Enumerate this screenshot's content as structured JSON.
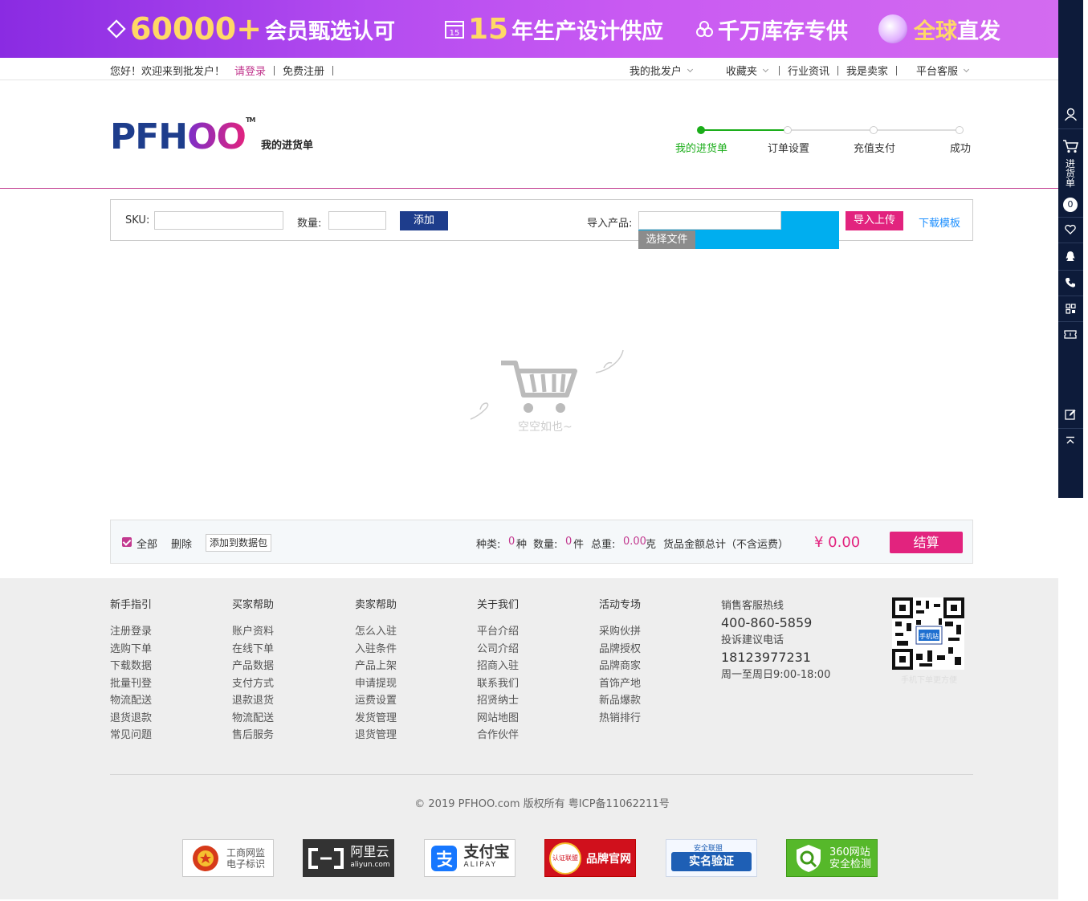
{
  "banner": {
    "seg1_num": "60000+",
    "seg1_txt": "会员甄选认可",
    "seg2_icon": "15",
    "seg2_num": "15",
    "seg2_txt": "年生产设计供应",
    "seg3_txt": "千万库存专供",
    "seg4_txt_a": "全球",
    "seg4_txt_b": "直发"
  },
  "topbar": {
    "greeting": "您好！欢迎来到批发户！",
    "login": "请登录",
    "register": "免费注册",
    "my_account": "我的批发户",
    "favorites": "收藏夹",
    "industry_news": "行业资讯",
    "i_am_seller": "我是卖家",
    "customer_service": "平台客服"
  },
  "header": {
    "logo_a": "PFH",
    "logo_b": "OO",
    "logo_tm": "TM",
    "page_name": "我的进货单",
    "steps": [
      "我的进货单",
      "订单设置",
      "充值支付",
      "成功"
    ]
  },
  "toolbox": {
    "sku_label": "SKU:",
    "qty_label": "数量:",
    "add_btn": "添加",
    "import_label": "导入产品:",
    "choose_file": "选择文件",
    "import_upload": "导入上传",
    "download_template": "下载模板"
  },
  "empty": {
    "text": "空空如也~"
  },
  "cartbar": {
    "all": "全部",
    "delete": "删除",
    "add_to_pkg": "添加到数据包",
    "kinds_label": "种类:",
    "kinds_value": "0",
    "kinds_unit": "种",
    "qty_label": "数量:",
    "qty_value": "0",
    "qty_unit": "件",
    "weight_label": "总重:",
    "weight_value": "0.00",
    "weight_unit": "克",
    "amount_label": "货品金额总计（不含运费）",
    "total": "¥ 0.00",
    "settle": "结算"
  },
  "footer": {
    "columns": [
      {
        "title": "新手指引",
        "items": [
          "注册登录",
          "选购下单",
          "下载数据",
          "批量刊登",
          "物流配送",
          "退货退款",
          "常见问题"
        ]
      },
      {
        "title": "买家帮助",
        "items": [
          "账户资料",
          "在线下单",
          "产品数据",
          "支付方式",
          "退款退货",
          "物流配送",
          "售后服务"
        ]
      },
      {
        "title": "卖家帮助",
        "items": [
          "怎么入驻",
          "入驻条件",
          "产品上架",
          "申请提现",
          "运费设置",
          "发货管理",
          "退货管理"
        ]
      },
      {
        "title": "关于我们",
        "items": [
          "平台介绍",
          "公司介绍",
          "招商入驻",
          "联系我们",
          "招贤纳士",
          "网站地图",
          "合作伙伴"
        ]
      },
      {
        "title": "活动专场",
        "items": [
          "采购伙拼",
          "品牌授权",
          "品牌商家",
          "首饰产地",
          "新品爆款",
          "热销排行"
        ]
      }
    ],
    "contact": {
      "sales_label": "销售客服热线",
      "sales_phone": "400-860-5859",
      "complaint_label": "投诉建议电话",
      "complaint_phone": "18123977231",
      "hours": "周一至周日9:00-18:00"
    },
    "qr_caption": "手机下单更方便",
    "qr_badge": "手机站",
    "copyright": "© 2019 PFHOO.com 版权所有 粤ICP备11062211号",
    "badges": [
      "工商网监\n电子标识",
      "阿里云",
      "支付宝",
      "品牌官网",
      "实名验证",
      "360网站\n安全检测"
    ],
    "badge_subs": {
      "aliyun": "aliyun.com",
      "alipay": "ALIPAY",
      "renzheng": "认证联盟",
      "anquan": "安全联盟"
    }
  },
  "sidebar": {
    "cart_label": "进货单",
    "cart_count": "0"
  },
  "colors": {
    "brand_blue": "#1e3d8c",
    "brand_pink": "#e2237e",
    "accent_magenta": "#c2398f",
    "step_green": "#1aad19",
    "sidebar_bg": "#0d1b3a"
  }
}
